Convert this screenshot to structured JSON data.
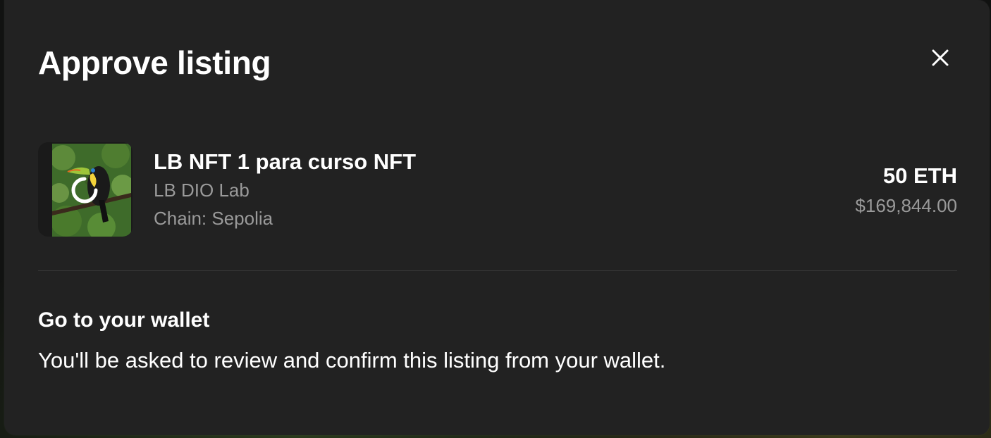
{
  "modal": {
    "title": "Approve listing",
    "close_icon": "close-icon"
  },
  "item": {
    "name": "LB NFT 1 para curso NFT",
    "collection": "LB DIO Lab",
    "chain": "Chain: Sepolia",
    "thumbnail_icon": "toucan-image",
    "loading_icon": "spinner-icon"
  },
  "price": {
    "eth": "50 ETH",
    "usd": "$169,844.00"
  },
  "step": {
    "title": "Go to your wallet",
    "description": "You'll be asked to review and confirm this listing from your wallet."
  },
  "colors": {
    "modal_bg": "#222222",
    "text_primary": "#ffffff",
    "text_secondary": "#9a9a9a",
    "divider": "#3a3a3a"
  }
}
